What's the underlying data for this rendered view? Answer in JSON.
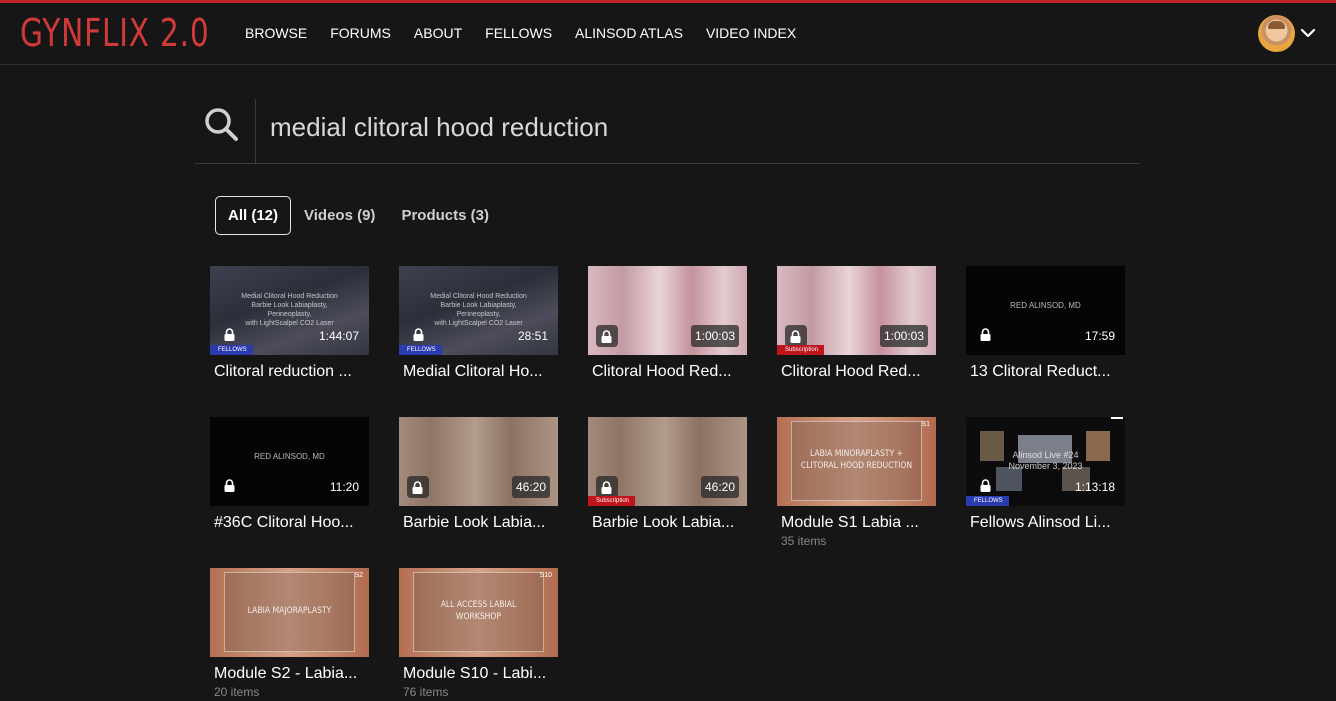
{
  "header": {
    "logo": "GYNFLIX 2.0",
    "nav": [
      "BROWSE",
      "FORUMS",
      "ABOUT",
      "FELLOWS",
      "ALINSOD ATLAS",
      "VIDEO INDEX"
    ]
  },
  "search": {
    "query": "medial clitoral hood reduction"
  },
  "tabs": [
    {
      "label": "All (12)",
      "active": true
    },
    {
      "label": "Videos (9)",
      "active": false
    },
    {
      "label": "Products (3)",
      "active": false
    }
  ],
  "cards": [
    {
      "title": "Clitoral reduction ...",
      "duration": "1:44:07",
      "badge": "FELLOWS",
      "overlay": [
        "Medial Clitoral Hood Reduction",
        "Barbie Look Labiaplasty,",
        "Perineoplasty,",
        "with LightScalpel CO2 Laser"
      ]
    },
    {
      "title": "Medial Clitoral Ho...",
      "duration": "28:51",
      "badge": "FELLOWS",
      "overlay": [
        "Medial Clitoral Hood Reduction",
        "Barbie Look Labiaplasty,",
        "Perineoplasty,",
        "with LightScalpel CO2 Laser"
      ]
    },
    {
      "title": "Clitoral Hood Red...",
      "duration": "1:00:03"
    },
    {
      "title": "Clitoral Hood Red...",
      "duration": "1:00:03",
      "badge": "Subscription"
    },
    {
      "title": "13 Clitoral Reduct...",
      "duration": "17:59",
      "overlay": [
        "RED ALINSOD, MD"
      ]
    },
    {
      "title": "#36C Clitoral Hoo...",
      "duration": "11:20",
      "overlay": [
        "RED ALINSOD, MD"
      ]
    },
    {
      "title": "Barbie Look Labia...",
      "duration": "46:20"
    },
    {
      "title": "Barbie Look Labia...",
      "duration": "46:20",
      "badge": "Subscription"
    },
    {
      "title": "Module S1 Labia ...",
      "items": "35 items",
      "tag": "S1",
      "overlay": [
        "LABIA MINORAPLASTY +",
        "CLITORAL HOOD REDUCTION"
      ]
    },
    {
      "title": "Fellows Alinsod Li...",
      "duration": "1:13:18",
      "badge": "FELLOWS",
      "overlay": [
        "Alinsod Live #24",
        "November 3, 2023"
      ]
    },
    {
      "title": "Module S2 - Labia...",
      "items": "20 items",
      "tag": "S2",
      "overlay": [
        "LABIA MAJORAPLASTY"
      ]
    },
    {
      "title": "Module S10 - Labi...",
      "items": "76 items",
      "tag": "S10",
      "overlay": [
        "ALL ACCESS LABIAL",
        "WORKSHOP"
      ]
    }
  ]
}
